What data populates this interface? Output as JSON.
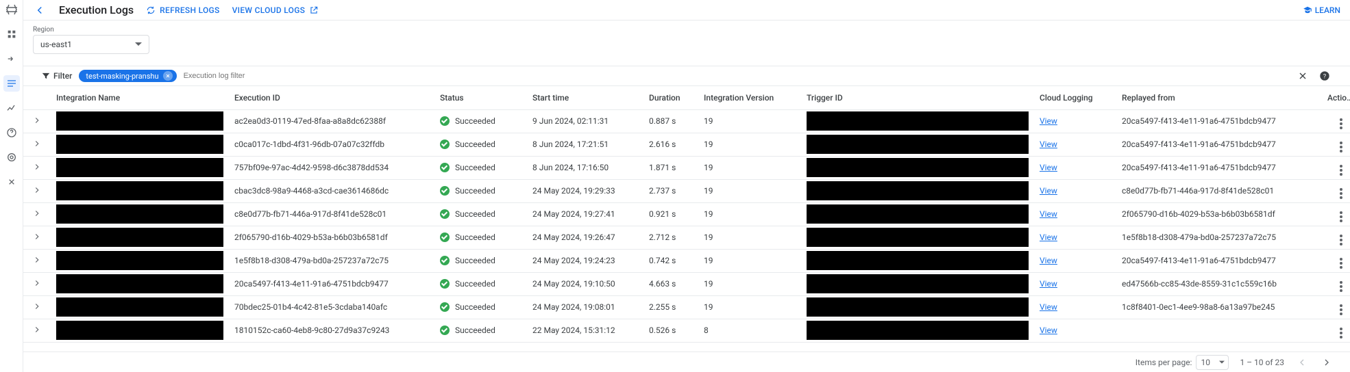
{
  "header": {
    "title": "Execution Logs",
    "refresh_label": "REFRESH LOGS",
    "view_cloud_logs_label": "VIEW CLOUD LOGS",
    "learn_label": "LEARN"
  },
  "region": {
    "label": "Region",
    "value": "us-east1"
  },
  "filter": {
    "toggle_label": "Filter",
    "chip_value": "test-masking-pranshu",
    "placeholder": "Execution log filter"
  },
  "columns": {
    "integration_name": "Integration Name",
    "execution_id": "Execution ID",
    "status": "Status",
    "start_time": "Start time",
    "duration": "Duration",
    "integration_version": "Integration Version",
    "trigger_id": "Trigger ID",
    "cloud_logging": "Cloud Logging",
    "replayed_from": "Replayed from",
    "actions": "Actions"
  },
  "view_link_label": "View",
  "rows": [
    {
      "integration_name": "[redacted]",
      "execution_id": "ac2ea0d3-0119-47ed-8faa-a8a8dc62388f",
      "status": "Succeeded",
      "start_time": "9 Jun 2024, 02:11:31",
      "duration": "0.887 s",
      "integration_version": "19",
      "trigger_id": "[redacted]",
      "cloud_logging": "View",
      "replayed_from": "20ca5497-f413-4e11-91a6-4751bdcb9477"
    },
    {
      "integration_name": "[redacted]",
      "execution_id": "c0ca017c-1dbd-4f31-96db-07a07c32ffdb",
      "status": "Succeeded",
      "start_time": "8 Jun 2024, 17:21:51",
      "duration": "2.616 s",
      "integration_version": "19",
      "trigger_id": "[redacted]",
      "cloud_logging": "View",
      "replayed_from": "20ca5497-f413-4e11-91a6-4751bdcb9477"
    },
    {
      "integration_name": "[redacted]",
      "execution_id": "757bf09e-97ac-4d42-9598-d6c3878dd534",
      "status": "Succeeded",
      "start_time": "8 Jun 2024, 17:16:50",
      "duration": "1.871 s",
      "integration_version": "19",
      "trigger_id": "[redacted]",
      "cloud_logging": "View",
      "replayed_from": "20ca5497-f413-4e11-91a6-4751bdcb9477"
    },
    {
      "integration_name": "[redacted]",
      "execution_id": "cbac3dc8-98a9-4468-a3cd-cae3614686dc",
      "status": "Succeeded",
      "start_time": "24 May 2024, 19:29:33",
      "duration": "2.737 s",
      "integration_version": "19",
      "trigger_id": "[redacted]",
      "cloud_logging": "View",
      "replayed_from": "c8e0d77b-fb71-446a-917d-8f41de528c01"
    },
    {
      "integration_name": "[redacted]",
      "execution_id": "c8e0d77b-fb71-446a-917d-8f41de528c01",
      "status": "Succeeded",
      "start_time": "24 May 2024, 19:27:41",
      "duration": "0.921 s",
      "integration_version": "19",
      "trigger_id": "[redacted]",
      "cloud_logging": "View",
      "replayed_from": "2f065790-d16b-4029-b53a-b6b03b6581df"
    },
    {
      "integration_name": "[redacted]",
      "execution_id": "2f065790-d16b-4029-b53a-b6b03b6581df",
      "status": "Succeeded",
      "start_time": "24 May 2024, 19:26:47",
      "duration": "2.712 s",
      "integration_version": "19",
      "trigger_id": "[redacted]",
      "cloud_logging": "View",
      "replayed_from": "1e5f8b18-d308-479a-bd0a-257237a72c75"
    },
    {
      "integration_name": "[redacted]",
      "execution_id": "1e5f8b18-d308-479a-bd0a-257237a72c75",
      "status": "Succeeded",
      "start_time": "24 May 2024, 19:24:23",
      "duration": "0.742 s",
      "integration_version": "19",
      "trigger_id": "[redacted]",
      "cloud_logging": "View",
      "replayed_from": "20ca5497-f413-4e11-91a6-4751bdcb9477"
    },
    {
      "integration_name": "[redacted]",
      "execution_id": "20ca5497-f413-4e11-91a6-4751bdcb9477",
      "status": "Succeeded",
      "start_time": "24 May 2024, 19:10:50",
      "duration": "4.663 s",
      "integration_version": "19",
      "trigger_id": "[redacted]",
      "cloud_logging": "View",
      "replayed_from": "ed47566b-cc85-43de-8559-31c1c559c16b"
    },
    {
      "integration_name": "[redacted]",
      "execution_id": "70bdec25-01b4-4c42-81e5-3cdaba140afc",
      "status": "Succeeded",
      "start_time": "24 May 2024, 19:08:01",
      "duration": "2.255 s",
      "integration_version": "19",
      "trigger_id": "[redacted]",
      "cloud_logging": "View",
      "replayed_from": "1c8f8401-0ec1-4ee9-98a8-6a13a97be245"
    },
    {
      "integration_name": "[redacted]",
      "execution_id": "1810152c-ca60-4eb8-9c80-27d9a37c9243",
      "status": "Succeeded",
      "start_time": "22 May 2024, 15:31:12",
      "duration": "0.526 s",
      "integration_version": "8",
      "trigger_id": "[redacted]",
      "cloud_logging": "View",
      "replayed_from": ""
    }
  ],
  "paginator": {
    "items_per_page_label": "Items per page:",
    "page_size": "10",
    "range_label": "1 – 10 of 23"
  }
}
